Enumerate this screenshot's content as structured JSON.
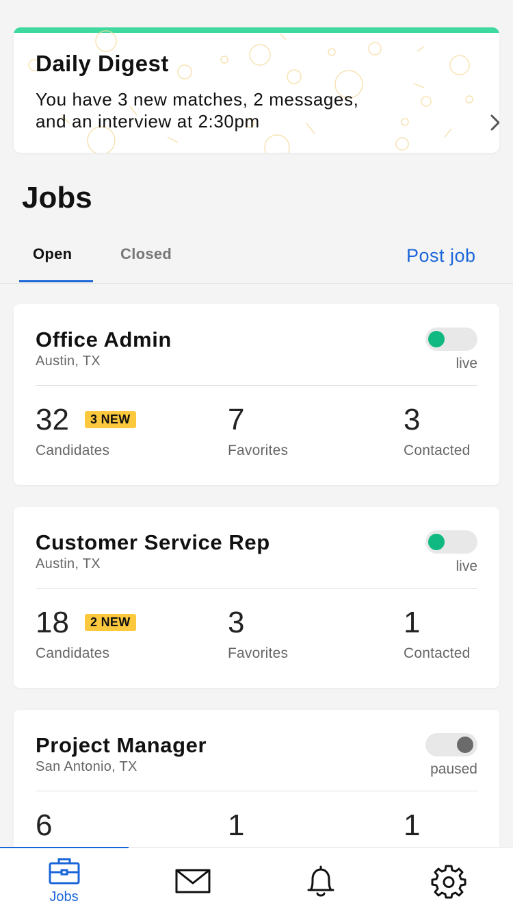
{
  "digest": {
    "title": "Daily Digest",
    "line1": "You have 3 new matches, 2 messages,",
    "line2": "and an interview at 2:30pm",
    "accent_color": "#3ed99e"
  },
  "jobs_heading": "Jobs",
  "tabs": {
    "open_label": "Open",
    "closed_label": "Closed",
    "active": "Open",
    "post_job_label": "Post job"
  },
  "jobs": [
    {
      "title": "Office Admin",
      "location": "Austin, TX",
      "status": "live",
      "candidates": "32",
      "new_badge": "3 NEW",
      "candidates_label": "Candidates",
      "favorites": "7",
      "favorites_label": "Favorites",
      "contacted": "3",
      "contacted_label": "Contacted"
    },
    {
      "title": "Customer Service Rep",
      "location": "Austin, TX",
      "status": "live",
      "candidates": "18",
      "new_badge": "2 NEW",
      "candidates_label": "Candidates",
      "favorites": "3",
      "favorites_label": "Favorites",
      "contacted": "1",
      "contacted_label": "Contacted"
    },
    {
      "title": "Project Manager",
      "location": "San Antonio, TX",
      "status": "paused",
      "candidates": "6",
      "favorites": "1",
      "contacted": "1"
    }
  ],
  "bottom_nav": {
    "items": [
      {
        "icon": "briefcase-icon",
        "label": "Jobs",
        "active": true
      },
      {
        "icon": "mail-icon"
      },
      {
        "icon": "bell-icon"
      },
      {
        "icon": "gear-icon"
      }
    ],
    "active_color": "#1a66d9"
  },
  "colors": {
    "live_green": "#10b981",
    "badge_yellow": "#fcc93e",
    "link_blue": "#1a66d9"
  }
}
